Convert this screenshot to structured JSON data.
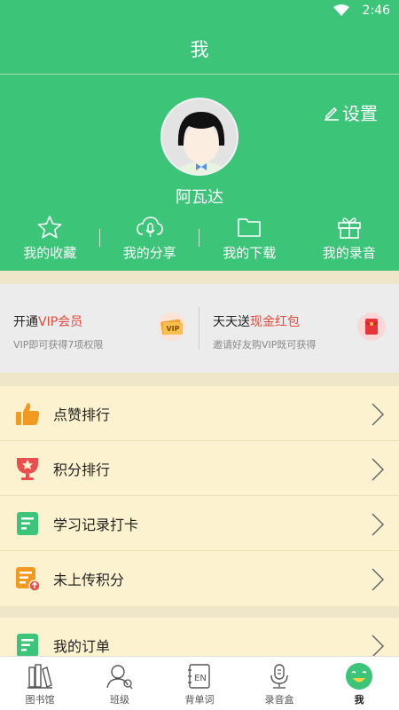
{
  "status_bar": {
    "time": "2:46"
  },
  "header": {
    "title": "我"
  },
  "profile": {
    "settings_label": "设置",
    "username": "阿瓦达"
  },
  "quick_actions": [
    {
      "label": "我的收藏",
      "icon": "star-icon"
    },
    {
      "label": "我的分享",
      "icon": "cloud-mic-icon"
    },
    {
      "label": "我的下载",
      "icon": "folder-icon"
    },
    {
      "label": "我的录音",
      "icon": "gift-icon"
    }
  ],
  "promo": {
    "vip": {
      "prefix": "开通",
      "highlight": "VIP会员",
      "sub": "VIP即可获得7项权限",
      "icon": "vip-card-icon"
    },
    "redpacket": {
      "prefix": "天天送",
      "highlight": "现金红包",
      "sub": "邀请好友购VIP既可获得",
      "icon": "red-packet-icon"
    }
  },
  "list_group_1": [
    {
      "label": "点赞排行",
      "icon": "thumbs-up-icon"
    },
    {
      "label": "积分排行",
      "icon": "trophy-icon"
    },
    {
      "label": "学习记录打卡",
      "icon": "document-icon"
    },
    {
      "label": "未上传积分",
      "icon": "upload-document-icon"
    }
  ],
  "list_group_2": [
    {
      "label": "我的订单",
      "icon": "order-icon"
    }
  ],
  "bottom_nav": [
    {
      "label": "图书馆",
      "icon": "library-icon"
    },
    {
      "label": "班级",
      "icon": "class-icon"
    },
    {
      "label": "背单词",
      "icon": "en-book-icon"
    },
    {
      "label": "录音盒",
      "icon": "recorder-icon"
    },
    {
      "label": "我",
      "icon": "smile-icon",
      "active": true
    }
  ],
  "colors": {
    "primary_green": "#3cc478",
    "accent_red": "#e64a3b",
    "icon_orange": "#f29a1f",
    "list_bg": "#fdf2cf"
  }
}
